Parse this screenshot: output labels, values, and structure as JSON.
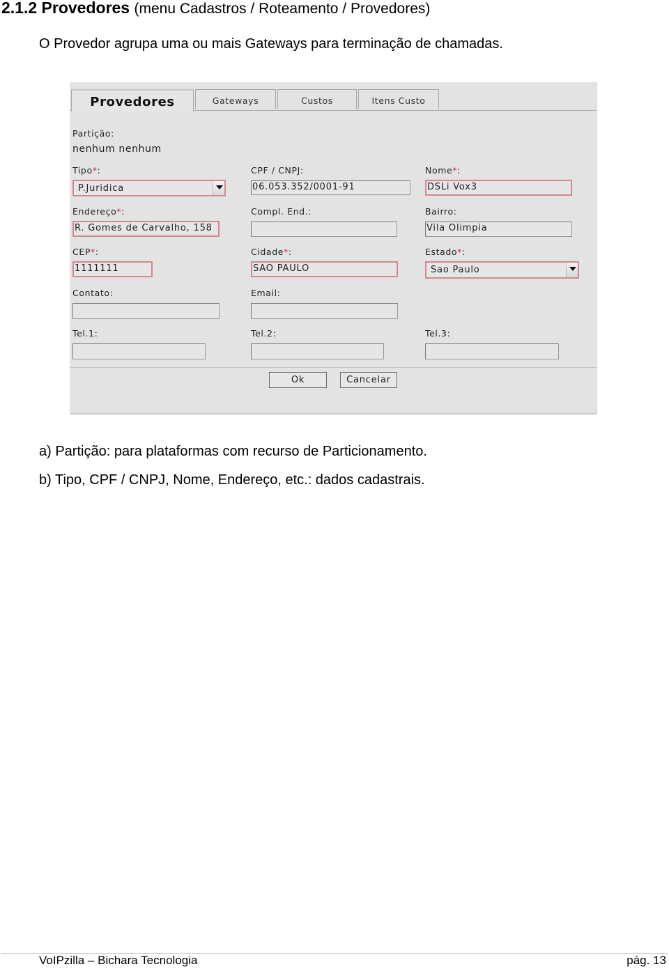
{
  "heading": {
    "number_title": "2.1.2 Provedores",
    "menu_path": "(menu Cadastros / Roteamento / Provedores)"
  },
  "intro": "O Provedor agrupa uma ou mais Gateways para terminação de chamadas.",
  "screenshot": {
    "tabs": [
      {
        "label": "Provedores",
        "active": true
      },
      {
        "label": "Gateways",
        "active": false
      },
      {
        "label": "Custos",
        "active": false
      },
      {
        "label": "Itens Custo",
        "active": false
      }
    ],
    "particao": {
      "label": "Partição:",
      "value": "nenhum nenhum"
    },
    "required_marker": "*",
    "fields": {
      "tipo": {
        "label": "Tipo",
        "required": true,
        "value": "P.Juridica",
        "type": "select"
      },
      "cpf_cnpj": {
        "label": "CPF / CNPJ:",
        "required": false,
        "value": "06.053.352/0001-91"
      },
      "nome": {
        "label": "Nome",
        "required": true,
        "value": "DSLi Vox3"
      },
      "endereco": {
        "label": "Endereço",
        "required": true,
        "value": "R. Gomes de Carvalho, 158"
      },
      "compl_end": {
        "label": "Compl. End.:",
        "required": false,
        "value": ""
      },
      "bairro": {
        "label": "Bairro:",
        "required": false,
        "value": "Vila Olimpia"
      },
      "cep": {
        "label": "CEP",
        "required": true,
        "value": "1111111"
      },
      "cidade": {
        "label": "Cidade",
        "required": true,
        "value": "SAO PAULO"
      },
      "estado": {
        "label": "Estado",
        "required": true,
        "value": "Sao Paulo",
        "type": "select"
      },
      "contato": {
        "label": "Contato:",
        "required": false,
        "value": ""
      },
      "email": {
        "label": "Email:",
        "required": false,
        "value": ""
      },
      "tel1": {
        "label": "Tel.1:",
        "required": false,
        "value": ""
      },
      "tel2": {
        "label": "Tel.2:",
        "required": false,
        "value": ""
      },
      "tel3": {
        "label": "Tel.3:",
        "required": false,
        "value": ""
      }
    },
    "label_suffix": ":",
    "buttons": {
      "ok": "Ok",
      "cancel": "Cancelar"
    }
  },
  "notes": [
    "a) Partição: para plataformas com recurso de Particionamento.",
    "b) Tipo, CPF / CNPJ, Nome, Endereço, etc.: dados cadastrais."
  ],
  "footer": {
    "left": "VoIPzilla – Bichara Tecnologia",
    "right": "pág. 13"
  },
  "colors": {
    "required_accent": "#c0303a",
    "required_border": "#d08a8f",
    "panel_bg": "#e3e3e3"
  }
}
